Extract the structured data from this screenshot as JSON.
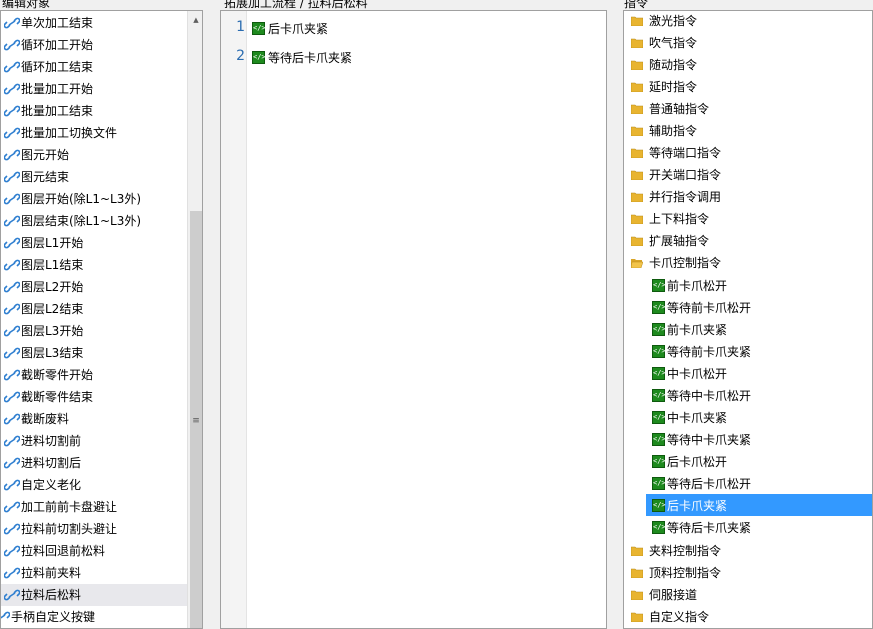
{
  "left_panel": {
    "title": "编辑对象",
    "items": [
      "单次加工结束",
      "循环加工开始",
      "循环加工结束",
      "批量加工开始",
      "批量加工结束",
      "批量加工切换文件",
      "图元开始",
      "图元结束",
      "图层开始(除L1~L3外)",
      "图层结束(除L1~L3外)",
      "图层L1开始",
      "图层L1结束",
      "图层L2开始",
      "图层L2结束",
      "图层L3开始",
      "图层L3结束",
      "截断零件开始",
      "截断零件结束",
      "截断废料",
      "进料切割前",
      "进料切割后",
      "自定义老化",
      "加工前前卡盘避让",
      "拉料前切割头避让",
      "拉料回退前松料",
      "拉料前夹料",
      "拉料后松料"
    ],
    "selected_item": "拉料后松料",
    "partial_bottom_item": "手柄自定义按键"
  },
  "middle_panel": {
    "title": "拓展加工流程 / 拉料后松料",
    "lines": [
      {
        "num": "1",
        "text": "后卡爪夹紧"
      },
      {
        "num": "2",
        "text": "等待后卡爪夹紧"
      }
    ]
  },
  "right_panel": {
    "title": "指令",
    "folders_before": [
      "激光指令",
      "吹气指令",
      "随动指令",
      "延时指令",
      "普通轴指令",
      "辅助指令",
      "等待端口指令",
      "开关端口指令",
      "并行指令调用",
      "上下料指令",
      "扩展轴指令"
    ],
    "open_folder": "卡爪控制指令",
    "open_folder_children": [
      "前卡爪松开",
      "等待前卡爪松开",
      "前卡爪夹紧",
      "等待前卡爪夹紧",
      "中卡爪松开",
      "等待中卡爪松开",
      "中卡爪夹紧",
      "等待中卡爪夹紧",
      "后卡爪松开",
      "等待后卡爪松开",
      "后卡爪夹紧",
      "等待后卡爪夹紧"
    ],
    "selected_child": "后卡爪夹紧",
    "folders_after": [
      "夹料控制指令",
      "顶料控制指令",
      "伺服接道",
      "自定义指令"
    ]
  },
  "colors": {
    "selection_blue": "#3399ff",
    "command_icon_green": "#1e8a1e",
    "folder_yellow": "#e8b430",
    "line_number_blue": "#2b6cb0"
  },
  "icons": {
    "left_item_icon": "link-icon",
    "command_icon": "code-command-icon",
    "folder_icon": "folder-icon",
    "open_folder_icon": "folder-open-icon"
  }
}
